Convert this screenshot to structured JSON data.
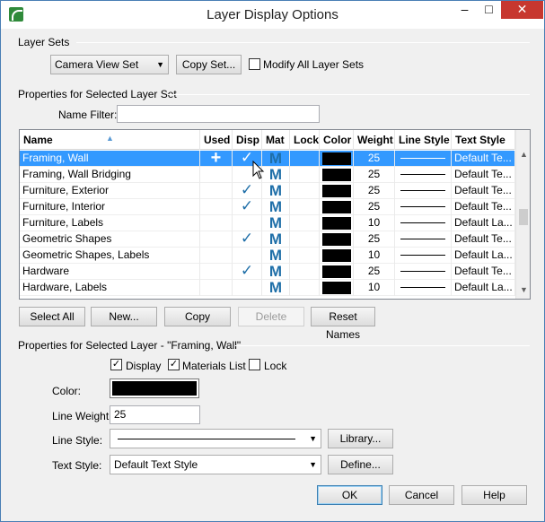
{
  "window": {
    "title": "Layer Display Options",
    "minimize": "–",
    "maximize": "□",
    "close": "✕"
  },
  "layer_sets": {
    "group_label": "Layer Sets",
    "selected": "Camera View Set",
    "copy_set_label": "Copy Set...",
    "modify_all_label": "Modify All Layer Sets",
    "modify_all_checked": false
  },
  "properties_set": {
    "group_label": "Properties for Selected Layer Set",
    "name_filter_label": "Name Filter:",
    "name_filter_value": ""
  },
  "table": {
    "columns": [
      "Name",
      "Used",
      "Disp",
      "Mat",
      "Lock",
      "Color",
      "Weight",
      "Line Style",
      "Text Style"
    ],
    "rows": [
      {
        "name": "Framing, Wall",
        "used": "+",
        "disp": "✓",
        "mat": "M",
        "lock": "",
        "color": "#000000",
        "weight": "25",
        "text_style": "Default Te...",
        "selected": true
      },
      {
        "name": "Framing, Wall Bridging",
        "used": "",
        "disp": "",
        "mat": "M",
        "lock": "",
        "color": "#000000",
        "weight": "25",
        "text_style": "Default Te...",
        "selected": false
      },
      {
        "name": "Furniture, Exterior",
        "used": "",
        "disp": "✓",
        "mat": "M",
        "lock": "",
        "color": "#000000",
        "weight": "25",
        "text_style": "Default Te...",
        "selected": false
      },
      {
        "name": "Furniture, Interior",
        "used": "",
        "disp": "✓",
        "mat": "M",
        "lock": "",
        "color": "#000000",
        "weight": "25",
        "text_style": "Default Te...",
        "selected": false
      },
      {
        "name": "Furniture, Labels",
        "used": "",
        "disp": "",
        "mat": "M",
        "lock": "",
        "color": "#000000",
        "weight": "10",
        "text_style": "Default La...",
        "selected": false
      },
      {
        "name": "Geometric Shapes",
        "used": "",
        "disp": "✓",
        "mat": "M",
        "lock": "",
        "color": "#000000",
        "weight": "25",
        "text_style": "Default Te...",
        "selected": false
      },
      {
        "name": "Geometric Shapes, Labels",
        "used": "",
        "disp": "",
        "mat": "M",
        "lock": "",
        "color": "#000000",
        "weight": "10",
        "text_style": "Default La...",
        "selected": false
      },
      {
        "name": "Hardware",
        "used": "",
        "disp": "✓",
        "mat": "M",
        "lock": "",
        "color": "#000000",
        "weight": "25",
        "text_style": "Default Te...",
        "selected": false
      },
      {
        "name": "Hardware, Labels",
        "used": "",
        "disp": "",
        "mat": "M",
        "lock": "",
        "color": "#000000",
        "weight": "10",
        "text_style": "Default La...",
        "selected": false
      }
    ]
  },
  "list_buttons": {
    "select_all": "Select All",
    "new": "New...",
    "copy": "Copy",
    "delete": "Delete",
    "reset_names": "Reset Names"
  },
  "layer_props": {
    "group_label": "Properties for Selected Layer - \"Framing, Wall\"",
    "display_label": "Display",
    "display_checked": true,
    "materials_label": "Materials List",
    "materials_checked": true,
    "lock_label": "Lock",
    "lock_checked": false,
    "color_label": "Color:",
    "color_value": "#000000",
    "line_weight_label": "Line Weight:",
    "line_weight_value": "25",
    "line_style_label": "Line Style:",
    "library_label": "Library...",
    "text_style_label": "Text Style:",
    "text_style_value": "Default Text Style",
    "define_label": "Define..."
  },
  "dialog_buttons": {
    "ok": "OK",
    "cancel": "Cancel",
    "help": "Help"
  }
}
